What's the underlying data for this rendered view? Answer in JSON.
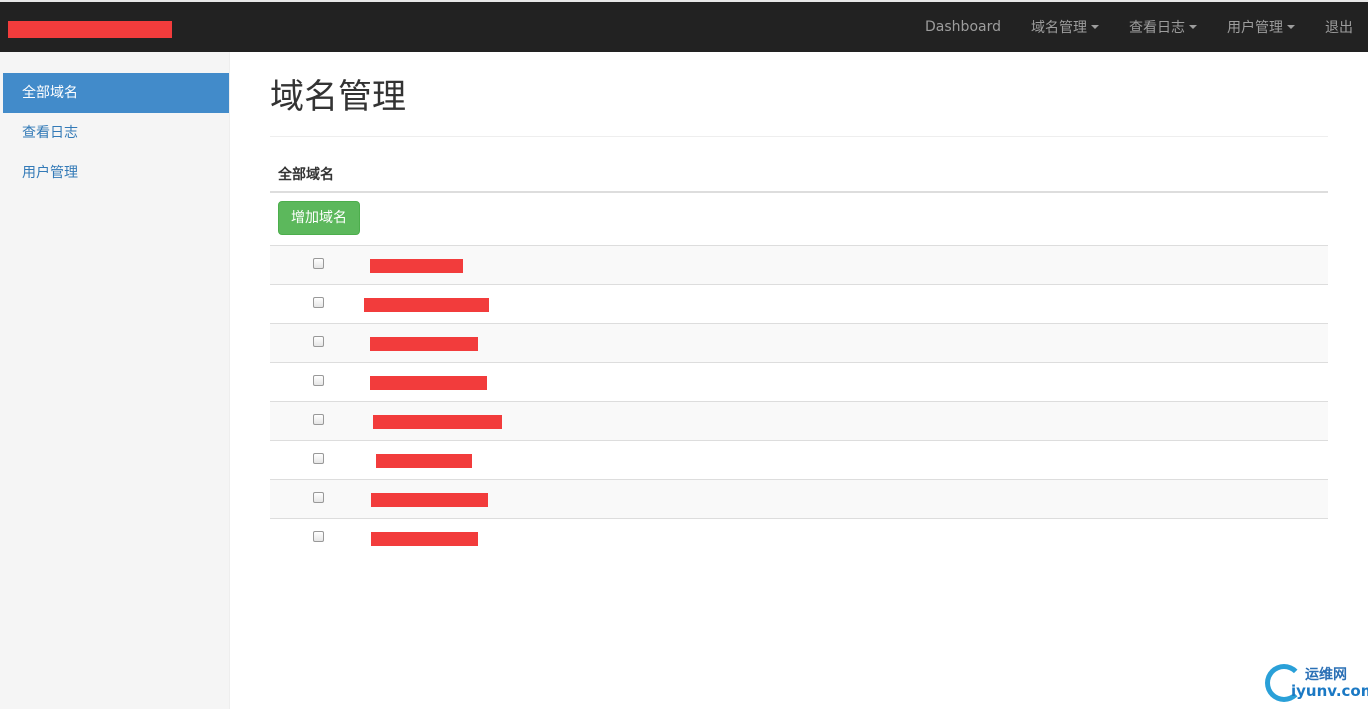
{
  "navbar": {
    "items": [
      {
        "label": "Dashboard",
        "dropdown": false
      },
      {
        "label": "域名管理",
        "dropdown": true
      },
      {
        "label": "查看日志",
        "dropdown": true
      },
      {
        "label": "用户管理",
        "dropdown": true
      },
      {
        "label": "退出",
        "dropdown": false
      }
    ]
  },
  "sidebar": {
    "items": [
      {
        "label": "全部域名",
        "active": true
      },
      {
        "label": "查看日志",
        "active": false
      },
      {
        "label": "用户管理",
        "active": false
      }
    ]
  },
  "main": {
    "title": "域名管理",
    "section_title": "全部域名",
    "add_button": "增加域名",
    "rows_count_visible": 8
  },
  "watermark": {
    "cn": "运维网",
    "en": "iyunv.com"
  },
  "colors": {
    "navbar_bg": "#222222",
    "sidebar_active": "#428bca",
    "button_success": "#5cb85c",
    "redaction": "#f23c3c"
  }
}
